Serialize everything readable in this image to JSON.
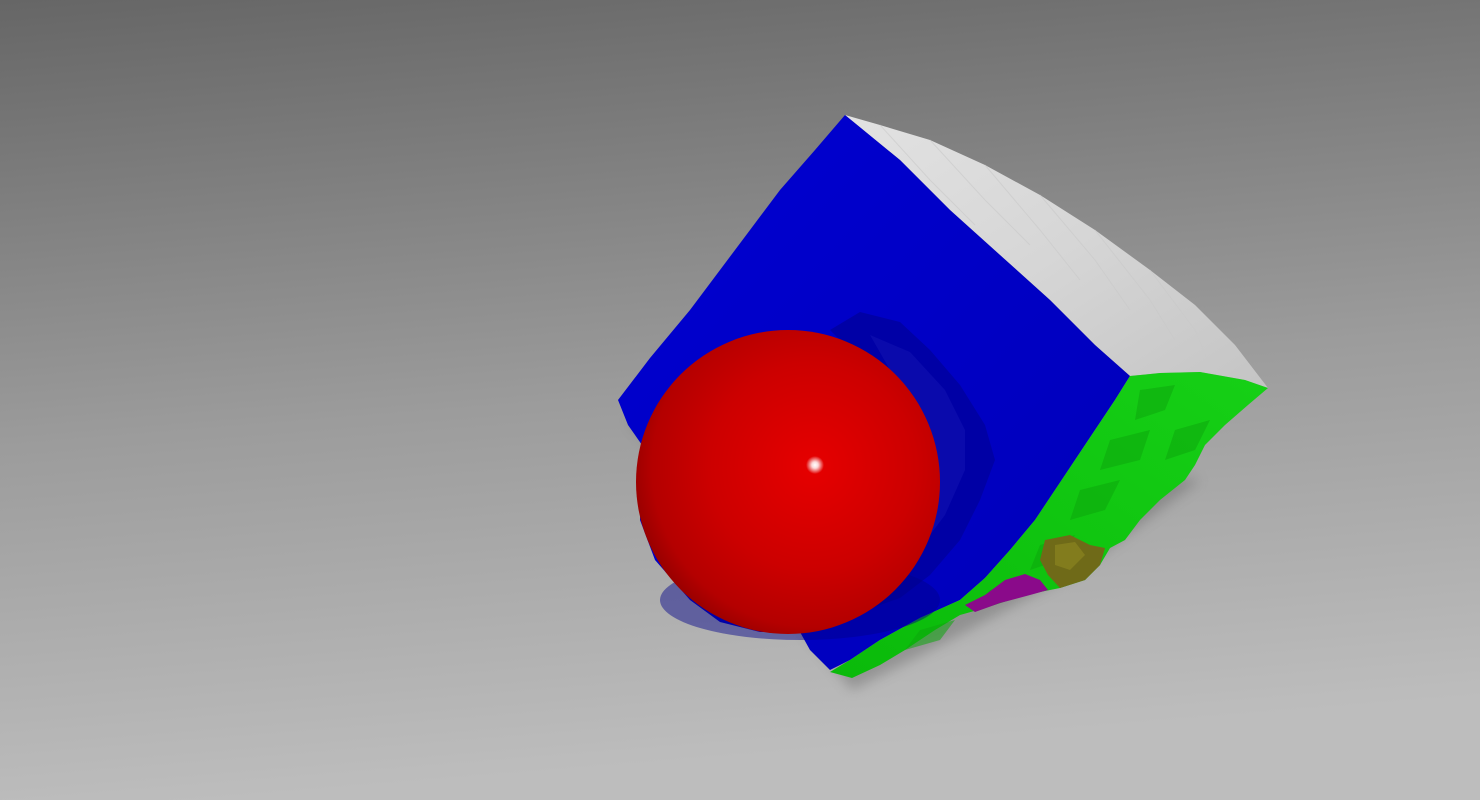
{
  "scene": {
    "background_top": "#6a6a6a",
    "background_bottom": "#b9b9b9",
    "sphere_color": "#d40000",
    "cube_face_front_color": "#0000c8",
    "cube_face_top_color": "#dcdcdc",
    "cube_face_side_color": "#10c810",
    "crumple_olive_color": "#6f6a18",
    "crumple_purple_color": "#8a0a8a",
    "specular_color": "#ffffff"
  }
}
